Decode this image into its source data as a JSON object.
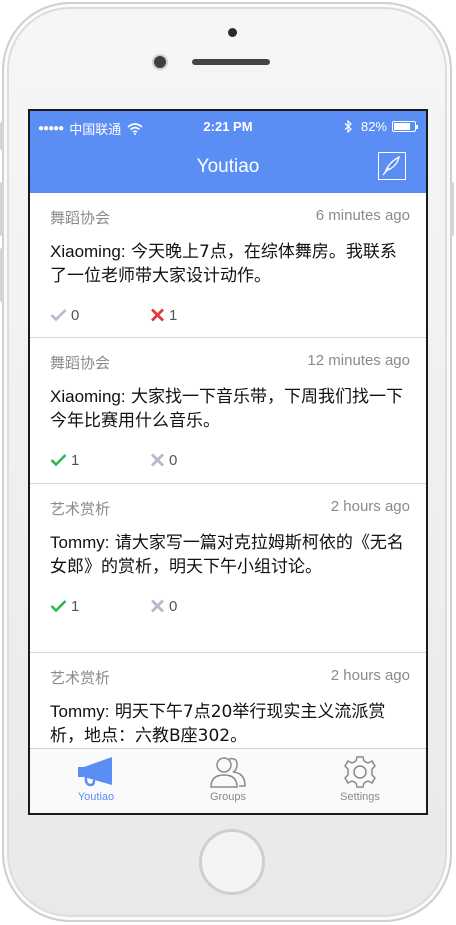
{
  "statusbar": {
    "carrier": "中国联通",
    "time": "2:21 PM",
    "battery_text": "82%",
    "battery_level": 0.82,
    "icons": [
      "signal-dots",
      "wifi-icon",
      "bluetooth-icon",
      "battery-icon"
    ]
  },
  "navbar": {
    "title": "Youtiao",
    "compose_icon": "compose-icon"
  },
  "colors": {
    "accent": "#5b8ef5",
    "check_active": "#2db84d",
    "cross_active": "#e0393e",
    "inactive": "#b8b8c8"
  },
  "posts": [
    {
      "group": "舞蹈协会",
      "time": "6 minutes ago",
      "author": "Xiaoming:",
      "text": " 今天晚上7点，在综体舞房。我联系了一位老师带大家设计动作。",
      "up": "0",
      "down": "1",
      "up_active": false,
      "down_active": true
    },
    {
      "group": "舞蹈协会",
      "time": "12 minutes ago",
      "author": "Xiaoming:",
      "text": " 大家找一下音乐带，下周我们找一下今年比赛用什么音乐。",
      "up": "1",
      "down": "0",
      "up_active": true,
      "down_active": false
    },
    {
      "group": "艺术赏析",
      "time": "2 hours ago",
      "author": "Tommy:",
      "text": " 请大家写一篇对克拉姆斯柯依的《无名女郎》的赏析，明天下午小组讨论。",
      "up": "1",
      "down": "0",
      "up_active": true,
      "down_active": false
    },
    {
      "group": "艺术赏析",
      "time": "2 hours ago",
      "author": "Tommy:",
      "text": " 明天下午7点20举行现实主义流派赏析，地点：六教B座302。",
      "up": "",
      "down": "",
      "up_active": false,
      "down_active": false
    }
  ],
  "tabs": [
    {
      "label": "Youtiao",
      "icon": "megaphone-icon",
      "active": true
    },
    {
      "label": "Groups",
      "icon": "groups-icon",
      "active": false
    },
    {
      "label": "Settings",
      "icon": "gear-icon",
      "active": false
    }
  ]
}
